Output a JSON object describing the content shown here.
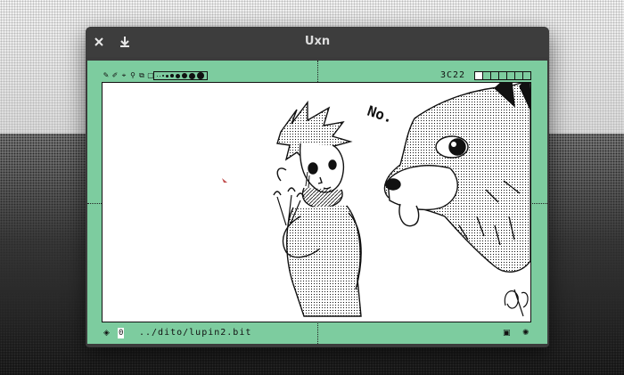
{
  "window": {
    "title": "Uxn"
  },
  "titlebar": {
    "close_icon": "close-icon",
    "save_icon": "download-icon"
  },
  "toolbar": {
    "tools": [
      "pencil-icon",
      "brush-icon",
      "selection-icon",
      "zoom-icon",
      "clone-icon",
      "frame-icon"
    ],
    "zoom_value": "3C22",
    "swatch_sizes": [
      1,
      1,
      2,
      3,
      4,
      5,
      6,
      7,
      8
    ]
  },
  "artwork": {
    "caption_text": "No."
  },
  "statusbar": {
    "mode_icon": "eye-icon",
    "index_value": "0",
    "file_path": "../dito/lupin2.bit",
    "right_icons": [
      "pattern-icon",
      "sun-icon"
    ]
  },
  "colors": {
    "screen_bg": "#7dcc9f",
    "ink": "#111111",
    "paper": "#ffffff",
    "window": "#3d3d3d"
  }
}
